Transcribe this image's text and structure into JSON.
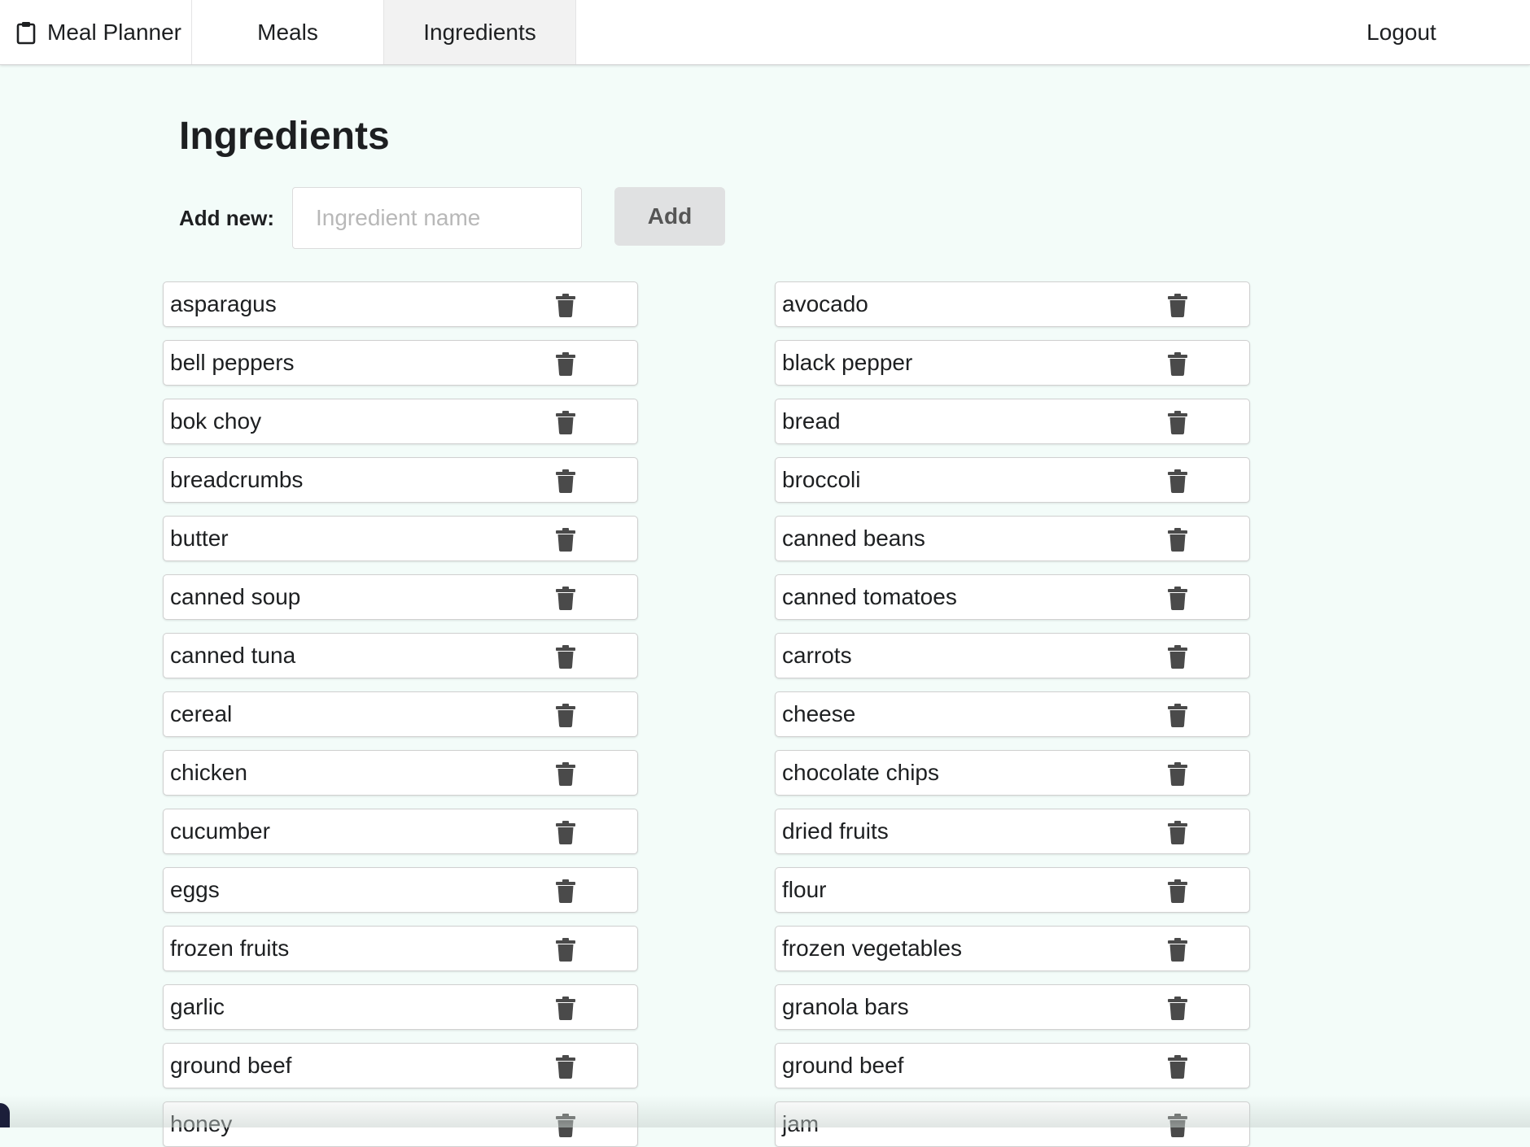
{
  "nav": {
    "brand": "Meal Planner",
    "brand_icon": "clipboard-icon",
    "tabs": [
      {
        "label": "Meals",
        "active": false
      },
      {
        "label": "Ingredients",
        "active": true
      }
    ],
    "logout_label": "Logout"
  },
  "page": {
    "title": "Ingredients",
    "add_label": "Add new:",
    "input_placeholder": "Ingredient name",
    "input_value": "",
    "add_button_label": "Add"
  },
  "ingredients": [
    {
      "name": "asparagus"
    },
    {
      "name": "avocado"
    },
    {
      "name": "bell peppers"
    },
    {
      "name": "black pepper"
    },
    {
      "name": "bok choy"
    },
    {
      "name": "bread"
    },
    {
      "name": "breadcrumbs"
    },
    {
      "name": "broccoli"
    },
    {
      "name": "butter"
    },
    {
      "name": "canned beans"
    },
    {
      "name": "canned soup"
    },
    {
      "name": "canned tomatoes"
    },
    {
      "name": "canned tuna"
    },
    {
      "name": "carrots"
    },
    {
      "name": "cereal"
    },
    {
      "name": "cheese"
    },
    {
      "name": "chicken"
    },
    {
      "name": "chocolate chips"
    },
    {
      "name": "cucumber"
    },
    {
      "name": "dried fruits"
    },
    {
      "name": "eggs"
    },
    {
      "name": "flour"
    },
    {
      "name": "frozen fruits"
    },
    {
      "name": "frozen vegetables"
    },
    {
      "name": "garlic"
    },
    {
      "name": "granola bars"
    },
    {
      "name": "ground beef"
    },
    {
      "name": "ground beef"
    },
    {
      "name": "honey"
    },
    {
      "name": "jam"
    }
  ],
  "delete_icon": "trash-icon",
  "colors": {
    "background": "#f3fcf9",
    "active_tab": "#f2f2f2",
    "add_button": "#e0e1e2",
    "trash_icon": "#4a4a4a"
  }
}
